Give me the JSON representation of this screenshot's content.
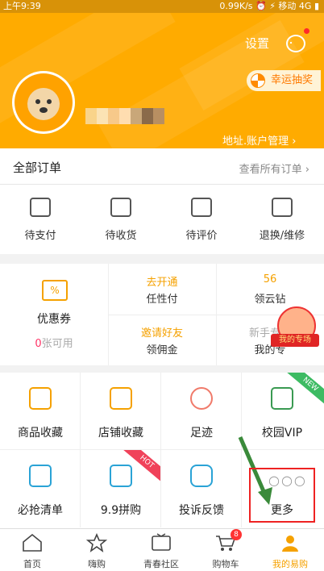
{
  "status_bar": {
    "time": "上午9:39",
    "right": "0.99K/s  ⏰  ⚡  移动 4G  ▮"
  },
  "header": {
    "settings_label": "设置",
    "lucky_draw_label": "幸运抽奖",
    "address_label": "地址.账户管理 ›",
    "brand_color": "#ffab00"
  },
  "orders": {
    "title": "全部订单",
    "view_all": "查看所有订单 ›",
    "items": [
      {
        "label": "待支付",
        "icon": "wallet-icon"
      },
      {
        "label": "待收货",
        "icon": "truck-icon"
      },
      {
        "label": "待评价",
        "icon": "edit-icon"
      },
      {
        "label": "退换/维修",
        "icon": "exchange-icon"
      }
    ]
  },
  "promo": {
    "coupon": {
      "label": "优惠券",
      "count": "0",
      "suffix": "张可用"
    },
    "cells": [
      {
        "top": "去开通",
        "bottom": "任性付"
      },
      {
        "top": "56",
        "bottom": "领云钻"
      },
      {
        "top": "邀请好友",
        "bottom": "领佣金"
      },
      {
        "top": "新手专享",
        "bottom": "我的专"
      }
    ],
    "badge": "我的专场"
  },
  "services": [
    {
      "label": "商品收藏",
      "icon": "folder-star-icon"
    },
    {
      "label": "店铺收藏",
      "icon": "shop-icon"
    },
    {
      "label": "足迹",
      "icon": "footprint-icon"
    },
    {
      "label": "校园VIP",
      "icon": "graduation-cap-icon",
      "tag": "NEW"
    },
    {
      "label": "必抢清单",
      "icon": "hand-tap-icon"
    },
    {
      "label": "9.9拼购",
      "icon": "group-buy-icon",
      "tag": "HOT"
    },
    {
      "label": "投诉反馈",
      "icon": "chat-icon"
    },
    {
      "label": "更多",
      "icon": "more-icon",
      "dots": "○○○"
    }
  ],
  "tabbar": [
    {
      "label": "首页",
      "icon": "home-icon"
    },
    {
      "label": "嗨购",
      "icon": "star-bag-icon"
    },
    {
      "label": "青春社区",
      "icon": "live-tv-icon"
    },
    {
      "label": "购物车",
      "icon": "cart-icon",
      "badge": "8"
    },
    {
      "label": "我的易购",
      "icon": "profile-icon"
    }
  ]
}
